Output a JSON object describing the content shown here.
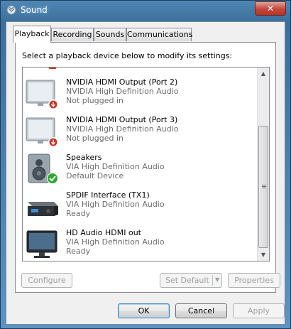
{
  "window": {
    "title": "Sound",
    "close_glyph": "✕"
  },
  "tabs": [
    {
      "label": "Playback",
      "active": true
    },
    {
      "label": "Recording",
      "active": false
    },
    {
      "label": "Sounds",
      "active": false
    },
    {
      "label": "Communications",
      "active": false
    }
  ],
  "playback": {
    "instruction": "Select a playback device below to modify its settings:",
    "devices": [
      {
        "name": "NVIDIA HDMI Output (Port 2)",
        "driver": "NVIDIA High Definition Audio",
        "status": "Not plugged in",
        "icon": "monitor-icon",
        "badge": "unplugged-badge-icon"
      },
      {
        "name": "NVIDIA HDMI Output (Port 3)",
        "driver": "NVIDIA High Definition Audio",
        "status": "Not plugged in",
        "icon": "monitor-icon",
        "badge": "unplugged-badge-icon"
      },
      {
        "name": "Speakers",
        "driver": "VIA High Definition Audio",
        "status": "Default Device",
        "icon": "speaker-icon",
        "badge": "default-check-icon"
      },
      {
        "name": "SPDIF Interface (TX1)",
        "driver": "VIA High Definition Audio",
        "status": "Ready",
        "icon": "spdif-receiver-icon"
      },
      {
        "name": "HD Audio HDMI out",
        "driver": "VIA High Definition Audio",
        "status": "Ready",
        "icon": "hdmi-monitor-icon"
      }
    ],
    "configure_label": "Configure",
    "set_default_label": "Set Default",
    "properties_label": "Properties"
  },
  "footer": {
    "ok_label": "OK",
    "cancel_label": "Cancel",
    "apply_label": "Apply"
  },
  "colors": {
    "title_bar": "#4f86b3",
    "close_button": "#c4463a",
    "disabled_text": "#a0a0a0",
    "secondary_text": "#6d6d6d",
    "default_check": "#2fa82f",
    "unplugged_badge": "#c0392b"
  }
}
